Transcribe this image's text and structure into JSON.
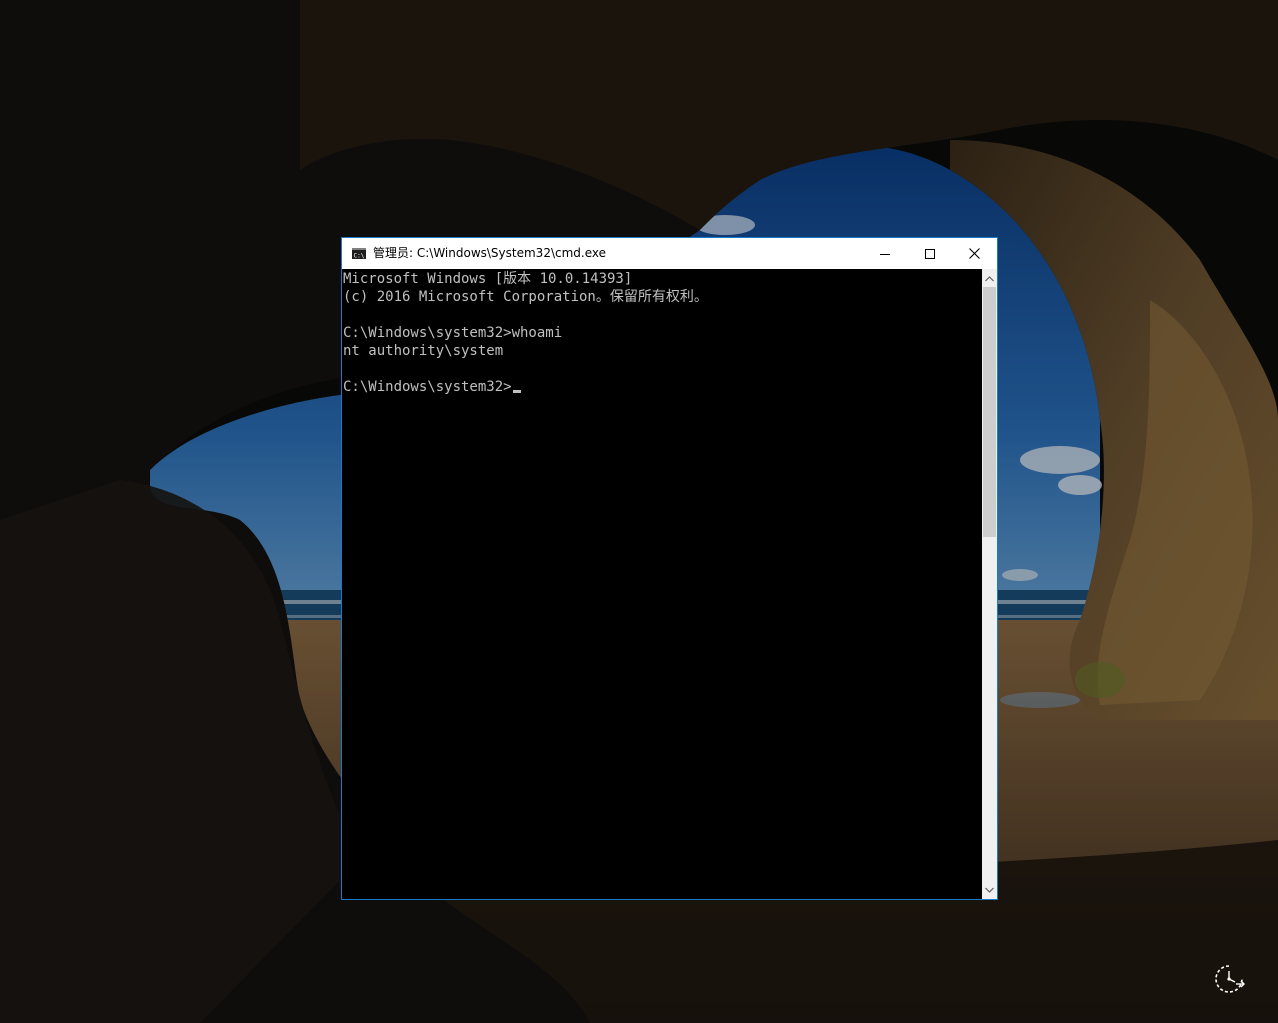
{
  "window": {
    "title": "管理员: C:\\Windows\\System32\\cmd.exe",
    "app_icon": "cmd-icon",
    "controls": {
      "minimize_icon": "minimize-icon",
      "maximize_icon": "maximize-icon",
      "close_icon": "close-icon"
    }
  },
  "console": {
    "lines": [
      "Microsoft Windows [版本 10.0.14393]",
      "(c) 2016 Microsoft Corporation。保留所有权利。",
      "",
      "C:\\Windows\\system32>whoami",
      "nt authority\\system",
      "",
      "C:\\Windows\\system32>"
    ],
    "text_color": "#c0c0c0",
    "background_color": "#000000"
  },
  "scrollbar": {
    "up_icon": "chevron-up-icon",
    "down_icon": "chevron-down-icon"
  },
  "desktop": {
    "ease_of_access_icon": "ease-of-access-icon",
    "accent_color": "#1979ca"
  }
}
